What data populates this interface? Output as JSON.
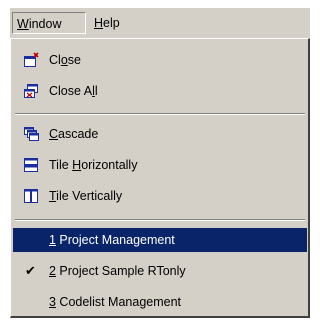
{
  "menubar": {
    "window": {
      "pre": "",
      "u": "W",
      "post": "indow"
    },
    "help": {
      "pre": "",
      "u": "H",
      "post": "elp"
    }
  },
  "menu": {
    "close": {
      "pre": "Cl",
      "u": "o",
      "post": "se",
      "icon": "close-window-icon"
    },
    "close_all": {
      "pre": "Close A",
      "u": "l",
      "post": "l",
      "icon": "close-all-icon"
    },
    "cascade": {
      "pre": "",
      "u": "C",
      "post": "ascade",
      "icon": "cascade-icon"
    },
    "tile_h": {
      "pre": "Tile ",
      "u": "H",
      "post": "orizontally",
      "icon": "tile-horizontal-icon"
    },
    "tile_v": {
      "pre": "",
      "u": "T",
      "post": "ile Vertically",
      "icon": "tile-vertical-icon"
    },
    "windows": [
      {
        "num": "1",
        "title": " Project Management",
        "selected": true,
        "checked": false
      },
      {
        "num": "2",
        "title": " Project Sample RTonly",
        "selected": false,
        "checked": true
      },
      {
        "num": "3",
        "title": " Codelist Management",
        "selected": false,
        "checked": false
      }
    ],
    "check_glyph": "✔"
  },
  "colors": {
    "menu_bg": "#d4d0c8",
    "highlight": "#0a246a",
    "icon_blue": "#1c2e9e"
  }
}
